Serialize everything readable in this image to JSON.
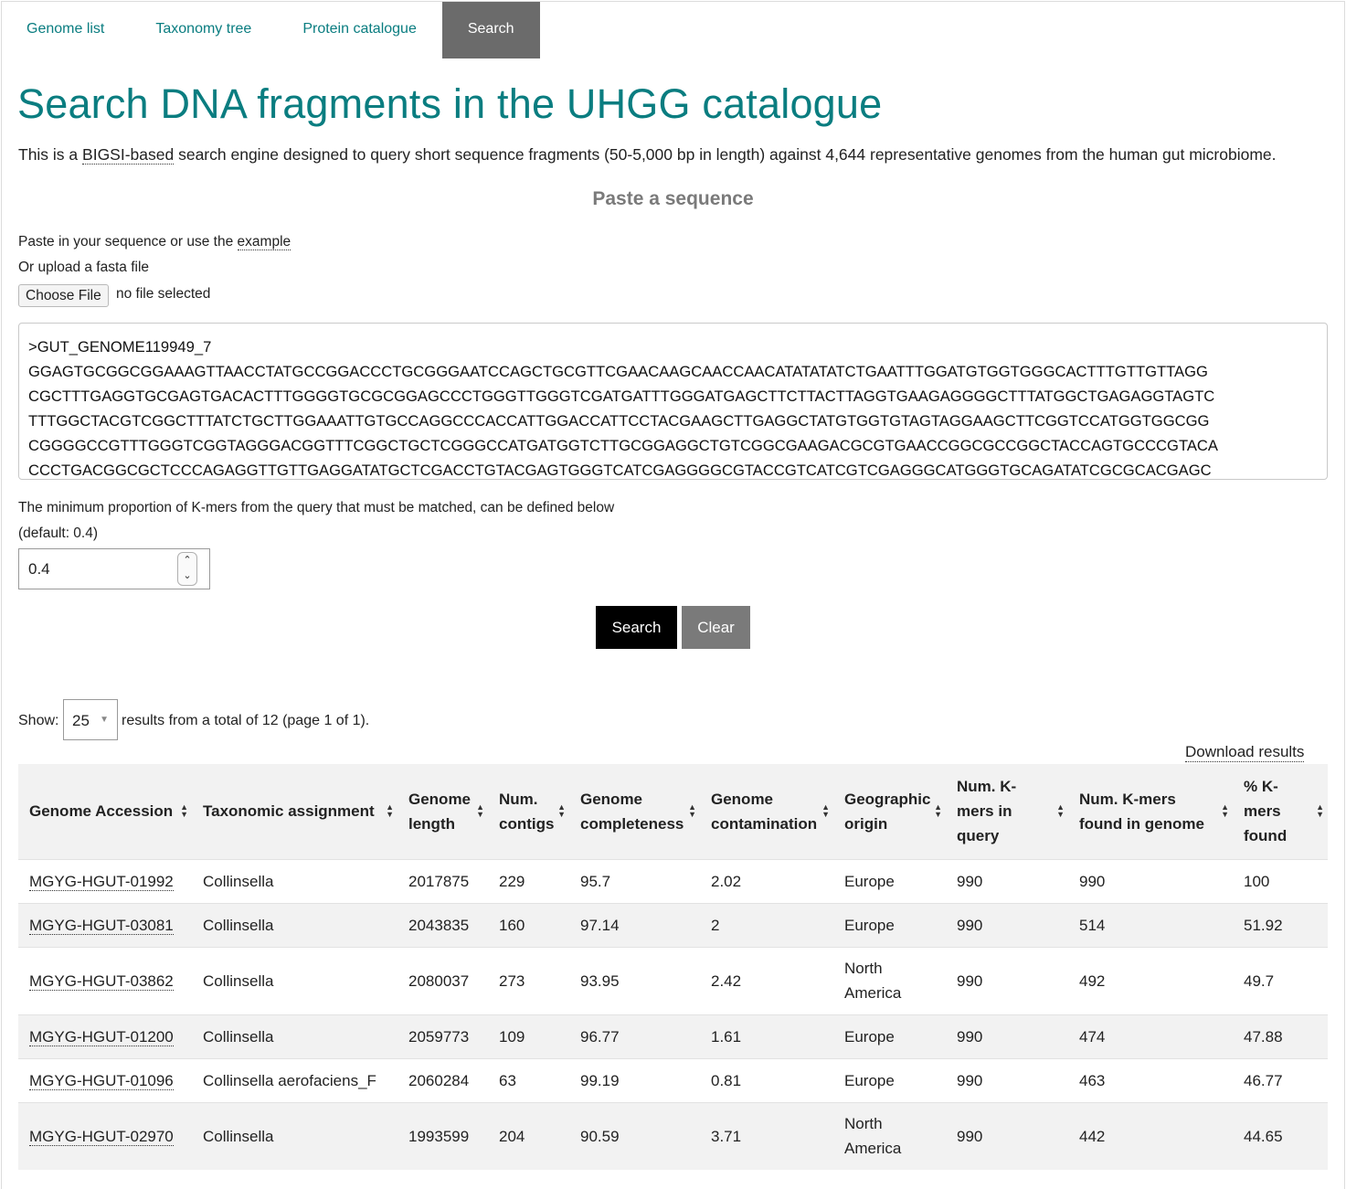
{
  "nav": {
    "tabs": [
      {
        "label": "Genome list",
        "active": false
      },
      {
        "label": "Taxonomy tree",
        "active": false
      },
      {
        "label": "Protein catalogue",
        "active": false
      },
      {
        "label": "Search",
        "active": true
      }
    ]
  },
  "page": {
    "title": "Search DNA fragments in the UHGG catalogue",
    "intro_pre": "This is a ",
    "intro_abbr": "BIGSI-based",
    "intro_post": " search engine designed to query short sequence fragments (50-5,000 bp in length) against 4,644 representative genomes from the human gut microbiome.",
    "section_title": "Paste a sequence"
  },
  "form": {
    "paste_hint": "Paste in your sequence or use the ",
    "example_link": "example",
    "upload_hint": "Or upload a fasta file",
    "choose_file": "Choose File",
    "no_file": "no file selected",
    "sequence": ">GUT_GENOME119949_7\nGGAGTGCGGCGGAAAGTTAACCTATGCCGGACCCTGCGGGAATCCAGCTGCGTTCGAACAAGCAACCAACATATATATCTGAATTTGGATGTGGTGGGCACTTTGTTGTTAGG\nCGCTTTGAGGTGCGAGTGACACTTTGGGGTGCGCGGAGCCCTGGGTTGGGTCGATGATTTGGGATGAGCTTCTTACTTAGGTGAAGAGGGGCTTTATGGCTGAGAGGTAGTC\nTTTGGCTACGTCGGCTTTATCTGCTTGGAAATTGTGCCAGGCCCACCATTGGACCATTCCTACGAAGCTTGAGGCTATGTGGTGTAGTAGGAAGCTTCGGTCCATGGTGGCGG\nCGGGGCCGTTTGGGTCGGTAGGGACGGTTTCGGCTGCTCGGGCCATGATGGTCTTGCGGAGGCTGTCGGCGAAGACGCGTGAACCGGCGCCGGCTACCAGTGCCCGTACA\nCCCTGACGGCGCTCCCAGAGGTTGTTGAGGATATGCTCGACCTGTACGAGTGGGTCATCGAGGGGCGTACCGTCATCGTCGAGGGCATGGGTGCAGATATCGCGCACGAGC",
    "kmer_hint": "The minimum proportion of K-mers from the query that must be matched, can be defined below",
    "kmer_default": "(default: 0.4)",
    "kmer_value": "0.4",
    "search_button": "Search",
    "clear_button": "Clear"
  },
  "results": {
    "show_label": "Show:",
    "page_size": "25",
    "summary": "results from a total of 12 (page 1 of 1).",
    "download": "Download results",
    "columns": [
      "Genome Accession",
      "Taxonomic assignment",
      "Genome length",
      "Num. contigs",
      "Genome completeness",
      "Genome contamination",
      "Geographic origin",
      "Num. K-mers in query",
      "Num. K-mers found in genome",
      "% K-mers found"
    ],
    "rows": [
      [
        "MGYG-HGUT-01992",
        "Collinsella",
        "2017875",
        "229",
        "95.7",
        "2.02",
        "Europe",
        "990",
        "990",
        "100"
      ],
      [
        "MGYG-HGUT-03081",
        "Collinsella",
        "2043835",
        "160",
        "97.14",
        "2",
        "Europe",
        "990",
        "514",
        "51.92"
      ],
      [
        "MGYG-HGUT-03862",
        "Collinsella",
        "2080037",
        "273",
        "93.95",
        "2.42",
        "North America",
        "990",
        "492",
        "49.7"
      ],
      [
        "MGYG-HGUT-01200",
        "Collinsella",
        "2059773",
        "109",
        "96.77",
        "1.61",
        "Europe",
        "990",
        "474",
        "47.88"
      ],
      [
        "MGYG-HGUT-01096",
        "Collinsella aerofaciens_F",
        "2060284",
        "63",
        "99.19",
        "0.81",
        "Europe",
        "990",
        "463",
        "46.77"
      ],
      [
        "MGYG-HGUT-02970",
        "Collinsella",
        "1993599",
        "204",
        "90.59",
        "3.71",
        "North America",
        "990",
        "442",
        "44.65"
      ]
    ]
  }
}
